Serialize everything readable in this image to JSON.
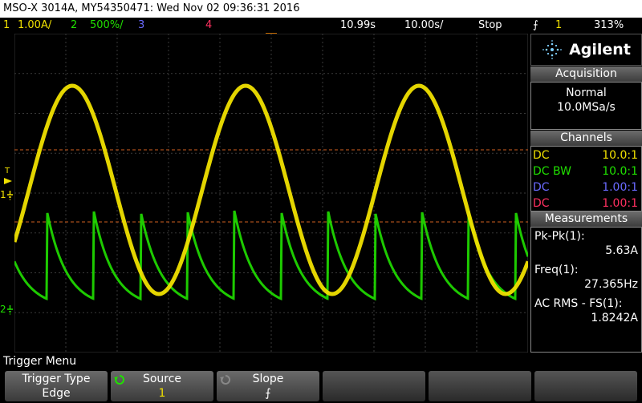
{
  "window": {
    "title": "MSO-X 3014A, MY54350471: Wed Nov 02 09:36:31 2016"
  },
  "status": {
    "ch1_num": "1",
    "ch1_scale": "1.00A/",
    "ch2_num": "2",
    "ch2_scale": "500%/",
    "ch3_num": "3",
    "ch4_num": "4",
    "timebase_delay": "10.99s",
    "timebase_scale": "10.00s/",
    "run_state": "Stop",
    "trig_slope": "⨍",
    "trig_src": "1",
    "trig_level": "313%"
  },
  "screen": {
    "ch1_marker": "1",
    "ch2_marker": "2",
    "trig_marker": "T"
  },
  "panel": {
    "brand": "Agilent",
    "acq_header": "Acquisition",
    "acq_mode": "Normal",
    "acq_rate": "10.0MSa/s",
    "channels_header": "Channels",
    "channels": [
      {
        "coupling": "DC",
        "ratio": "10.0:1",
        "color": "#f0e000"
      },
      {
        "coupling": "DC BW",
        "ratio": "10.0:1",
        "color": "#00e000"
      },
      {
        "coupling": "DC",
        "ratio": "1.00:1",
        "color": "#6a6aff"
      },
      {
        "coupling": "DC",
        "ratio": "1.00:1",
        "color": "#ff3060"
      }
    ],
    "meas_header": "Measurements",
    "measurements": [
      {
        "label": "Pk-Pk(1):",
        "value": "5.63A"
      },
      {
        "label": "Freq(1):",
        "value": "27.365Hz"
      },
      {
        "label": "AC RMS - FS(1):",
        "value": "1.8242A"
      }
    ]
  },
  "softkeys": {
    "menu_title": "Trigger Menu",
    "keys": [
      {
        "top": "Trigger Type",
        "bottom": "Edge"
      },
      {
        "top": "Source",
        "bottom": "1"
      },
      {
        "top": "Slope",
        "bottom": "⨍"
      }
    ]
  },
  "colors": {
    "ch1": "#f0e000",
    "ch2": "#20e000",
    "ch3": "#6a6aff",
    "ch4": "#ff3060",
    "grid": "#3a3a3a",
    "cursor": "#d06020"
  }
}
